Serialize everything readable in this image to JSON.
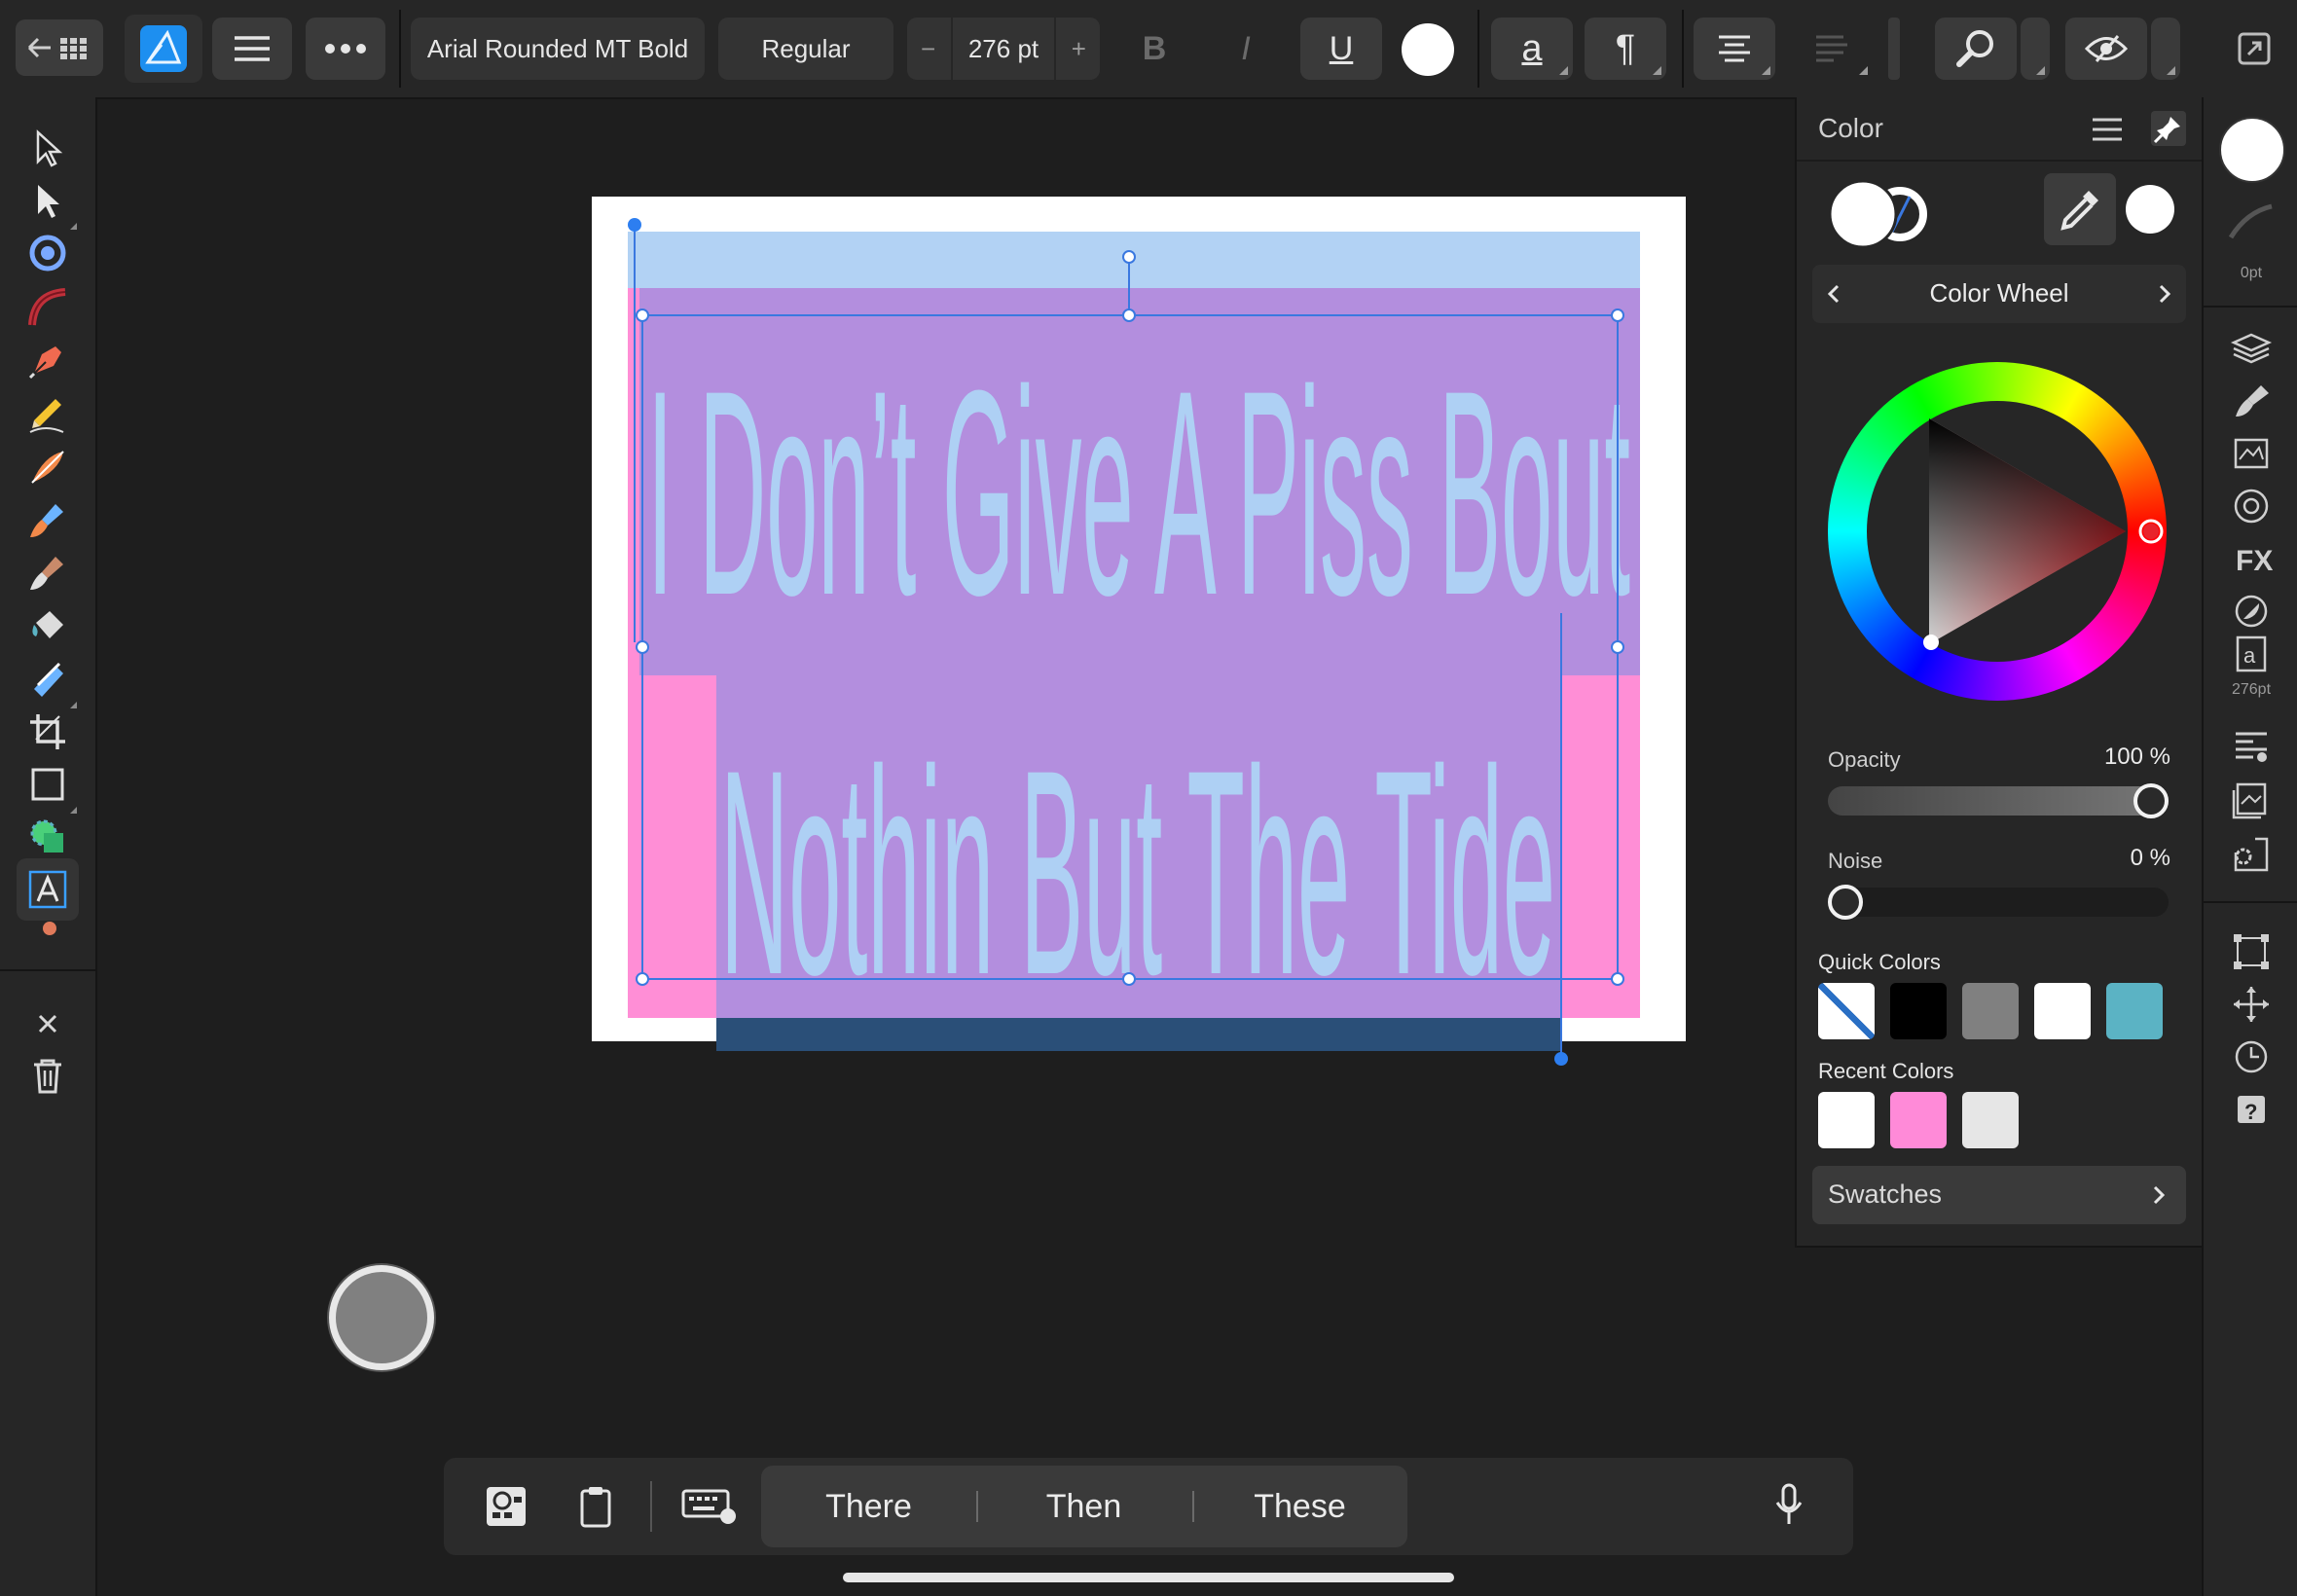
{
  "toolbar": {
    "font_family": "Arial Rounded MT Bold",
    "font_style": "Regular",
    "font_size": "276 pt",
    "decrement_label": "−",
    "increment_label": "+",
    "bold_label": "B",
    "italic_label": "I",
    "underline_label": "U",
    "text_style_label": "a",
    "paragraph_label": "¶"
  },
  "color_panel": {
    "title": "Color",
    "mode_label": "Color Wheel",
    "opacity_label": "Opacity",
    "opacity_value": "100 %",
    "opacity_fraction": 1.0,
    "noise_label": "Noise",
    "noise_value": "0 %",
    "noise_fraction": 0.0,
    "quick_colors_label": "Quick Colors",
    "quick_colors": [
      "none",
      "#000000",
      "#808080",
      "#ffffff",
      "#5bb3c4"
    ],
    "recent_colors_label": "Recent Colors",
    "recent_colors": [
      "#ffffff",
      "#ff8ad8",
      "#e6e6e6"
    ],
    "swatches_label": "Swatches",
    "fill_color": "#ffffff",
    "selected_hue_color": "#e8232b"
  },
  "right_strip": {
    "stroke_width_label": "0pt",
    "text_size_label": "276pt"
  },
  "document": {
    "line1": "I Don’t Give A Piss Bout",
    "line2": "Nothin But The Tide",
    "text_color": "#aed0f4",
    "highlight_color": "#b38ede",
    "pink_color": "#ff8ed6",
    "page_color": "#ffffff"
  },
  "keyboard_bar": {
    "suggestions": [
      "There",
      "Then",
      "These"
    ]
  }
}
